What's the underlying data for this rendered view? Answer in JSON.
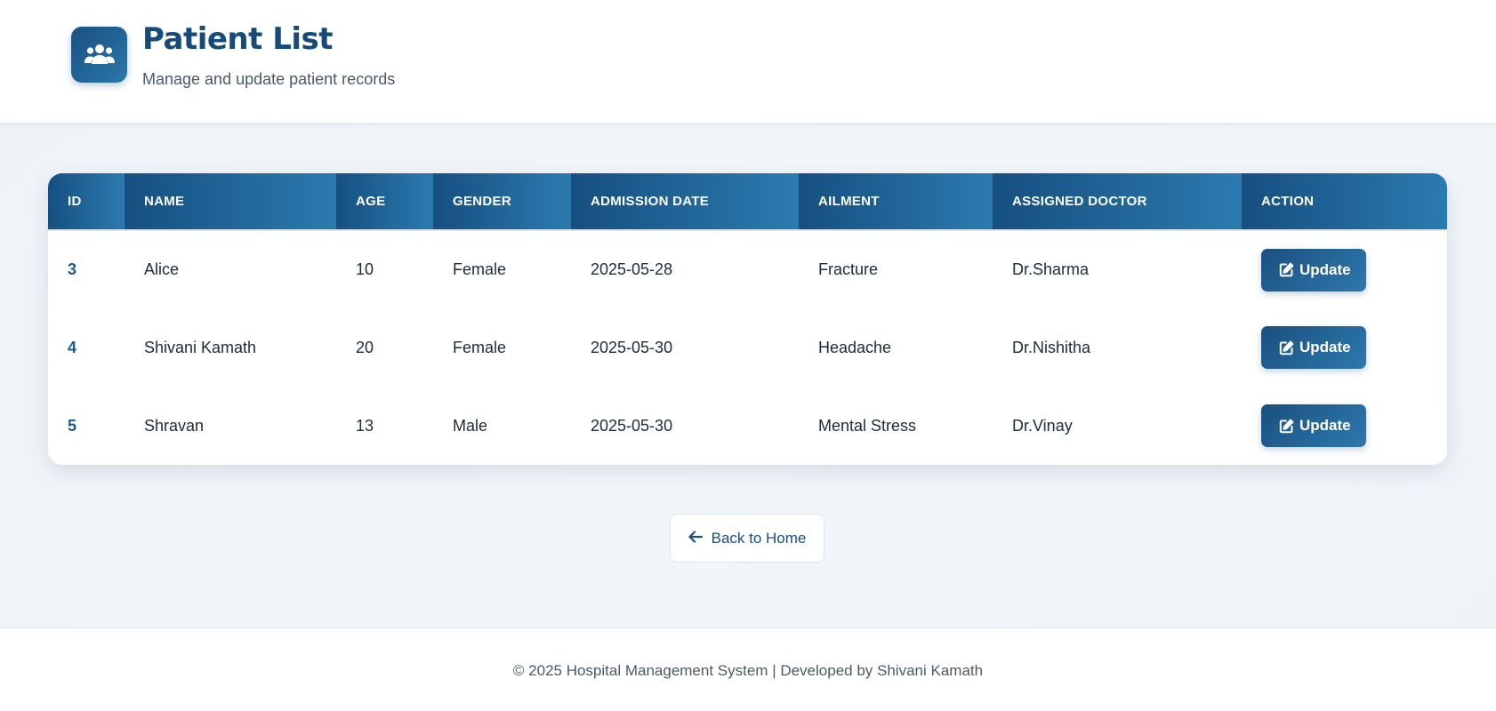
{
  "header": {
    "icon": "users-icon",
    "title": "Patient List",
    "subtitle": "Manage and update patient records"
  },
  "table": {
    "columns": [
      "ID",
      "NAME",
      "AGE",
      "GENDER",
      "ADMISSION DATE",
      "AILMENT",
      "ASSIGNED DOCTOR",
      "ACTION"
    ],
    "rows": [
      {
        "id": "3",
        "name": "Alice",
        "age": "10",
        "gender": "Female",
        "admission_date": "2025-05-28",
        "ailment": "Fracture",
        "doctor": "Dr.Sharma",
        "action_label": "Update"
      },
      {
        "id": "4",
        "name": "Shivani Kamath",
        "age": "20",
        "gender": "Female",
        "admission_date": "2025-05-30",
        "ailment": "Headache",
        "doctor": "Dr.Nishitha",
        "action_label": "Update"
      },
      {
        "id": "5",
        "name": "Shravan",
        "age": "13",
        "gender": "Male",
        "admission_date": "2025-05-30",
        "ailment": "Mental Stress",
        "doctor": "Dr.Vinay",
        "action_label": "Update"
      }
    ],
    "action_icon": "edit-icon"
  },
  "back_button": {
    "icon": "arrow-left-icon",
    "label": "Back to Home"
  },
  "footer": {
    "text": "© 2025 Hospital Management System | Developed by Shivani Kamath"
  },
  "colors": {
    "primary": "#1a5080",
    "primary_light": "#2b7bb0",
    "title": "#164a78",
    "background": "#eef3f7"
  }
}
